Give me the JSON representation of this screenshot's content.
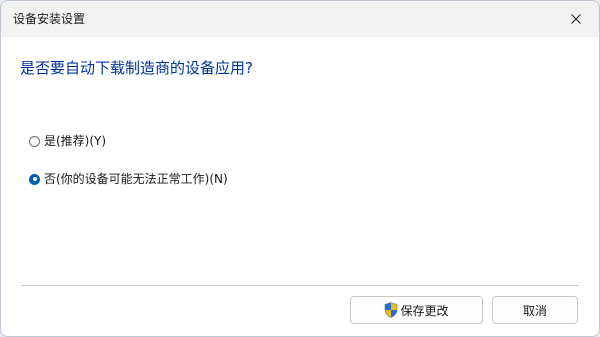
{
  "window": {
    "title": "设备安装设置"
  },
  "dialog": {
    "question": "是否要自动下载制造商的设备应用?",
    "options": [
      {
        "label": "是(推荐)(Y)",
        "selected": false
      },
      {
        "label": "否(你的设备可能无法正常工作)(N)",
        "selected": true
      }
    ]
  },
  "buttons": {
    "save_label": "保存更改",
    "cancel_label": "取消"
  },
  "icons": {
    "close": "close-icon",
    "save": "uac-shield-icon"
  },
  "colors": {
    "question_text": "#003399",
    "radio_selected": "#005fb8"
  }
}
